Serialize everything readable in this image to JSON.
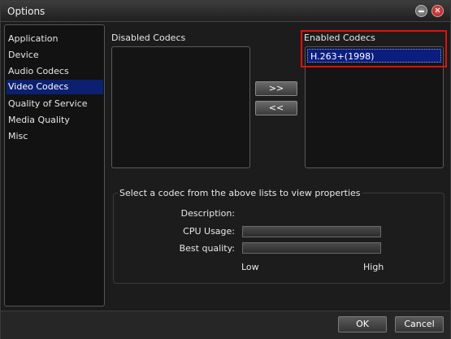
{
  "window": {
    "title": "Options"
  },
  "sidebar": {
    "items": [
      {
        "label": "Application"
      },
      {
        "label": "Device"
      },
      {
        "label": "Audio Codecs"
      },
      {
        "label": "Video Codecs"
      },
      {
        "label": "Quality of Service"
      },
      {
        "label": "Media Quality"
      },
      {
        "label": "Misc"
      }
    ],
    "selected": "Video Codecs"
  },
  "disabled_codecs": {
    "label": "Disabled Codecs",
    "items": []
  },
  "enabled_codecs": {
    "label": "Enabled Codecs",
    "items": [
      "H.263+(1998)"
    ]
  },
  "move_buttons": {
    "enable_label": ">>",
    "disable_label": "<<"
  },
  "properties": {
    "title": "Select a codec from the above lists to view properties",
    "description_label": "Description:",
    "cpu_usage_label": "CPU Usage:",
    "best_quality_label": "Best quality:",
    "scale_low": "Low",
    "scale_high": "High"
  },
  "footer": {
    "ok_label": "OK",
    "cancel_label": "Cancel"
  },
  "colors": {
    "selection": "#0b2070",
    "highlight_outline": "#e01010",
    "background": "#1c1c1c"
  }
}
